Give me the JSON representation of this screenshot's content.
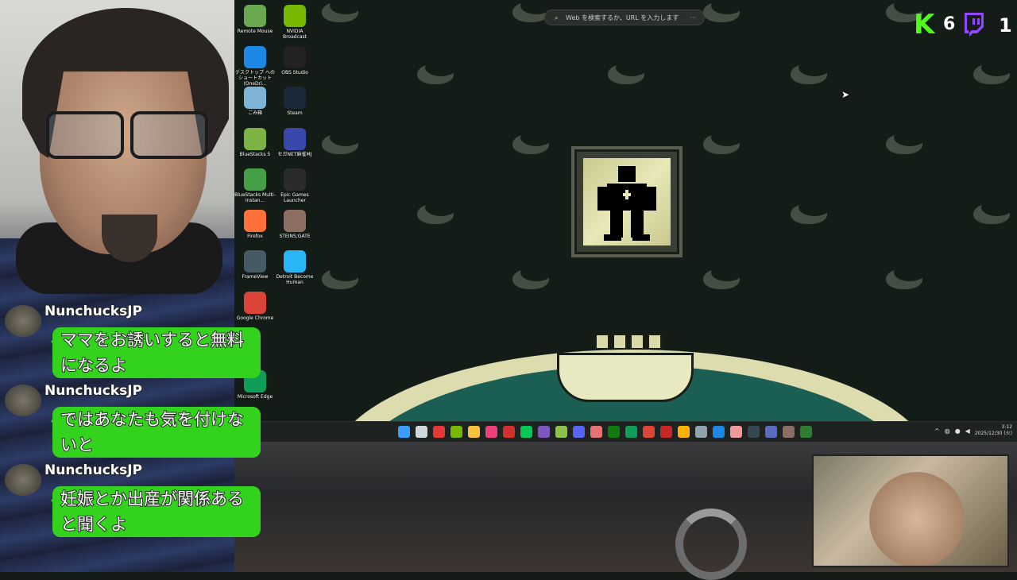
{
  "desktop_icons": [
    {
      "label": "Remote Mouse",
      "icon": "remote-mouse-icon",
      "color": "#6aa84f"
    },
    {
      "label": "NVIDIA Broadcast",
      "icon": "nvidia-broadcast-icon",
      "color": "#76b900"
    },
    {
      "label": "デスクトップ へのショートカット (OneDri...",
      "icon": "onedrive-icon",
      "color": "#1e88e5"
    },
    {
      "label": "OBS Studio",
      "icon": "obs-icon",
      "color": "#222222"
    },
    {
      "label": "ごみ箱",
      "icon": "recycle-bin-icon",
      "color": "#7fb3d5"
    },
    {
      "label": "Steam",
      "icon": "steam-icon",
      "color": "#1b2838"
    },
    {
      "label": "BlueStacks 5",
      "icon": "bluestacks-icon",
      "color": "#7cb342"
    },
    {
      "label": "セガNET麻雀MJ",
      "icon": "sega-mj-icon",
      "color": "#3949ab"
    },
    {
      "label": "BlueStacks Multi-Instan...",
      "icon": "bluestacks-multi-icon",
      "color": "#43a047"
    },
    {
      "label": "Epic Games Launcher",
      "icon": "epic-games-icon",
      "color": "#2b2b2b"
    },
    {
      "label": "Firefox",
      "icon": "firefox-icon",
      "color": "#ff7139"
    },
    {
      "label": "STEINS;GATE",
      "icon": "steins-gate-icon",
      "color": "#8d6e63"
    },
    {
      "label": "FrameView",
      "icon": "frameview-icon",
      "color": "#455a64"
    },
    {
      "label": "Detroit Become Human",
      "icon": "detroit-icon",
      "color": "#29b6f6"
    },
    {
      "label": "Google Chrome",
      "icon": "chrome-icon",
      "color": "#db4437"
    },
    {
      "label": "Microsoft Edge",
      "icon": "edge-icon",
      "color": "#0f9d58"
    }
  ],
  "search": {
    "placeholder": "Web を検索するか、URL を入力します",
    "icon": "search-icon",
    "more": "···"
  },
  "stream": {
    "kick_logo": "K",
    "kick_count": "6",
    "twitch_icon": "twitch-icon",
    "twitch_count": "1"
  },
  "taskbar": {
    "icons": [
      {
        "name": "start-icon",
        "color": "#3b9dfc"
      },
      {
        "name": "task-view-icon",
        "color": "#cfd8dc"
      },
      {
        "name": "obs-taskbar-icon",
        "color": "#e53935"
      },
      {
        "name": "nvidia-taskbar-icon",
        "color": "#76b900"
      },
      {
        "name": "file-explorer-icon",
        "color": "#f9c23c"
      },
      {
        "name": "app-pink-icon",
        "color": "#ec407a"
      },
      {
        "name": "record-icon",
        "color": "#d32f2f"
      },
      {
        "name": "line-icon",
        "color": "#06c755"
      },
      {
        "name": "app-purple-icon",
        "color": "#7e57c2"
      },
      {
        "name": "notepad-icon",
        "color": "#8bc34a"
      },
      {
        "name": "discord-icon",
        "color": "#5865f2"
      },
      {
        "name": "app-a-icon",
        "color": "#e57373"
      },
      {
        "name": "xbox-icon",
        "color": "#107c10"
      },
      {
        "name": "edge-taskbar-icon",
        "color": "#0f9d58"
      },
      {
        "name": "chrome-taskbar-icon",
        "color": "#db4437"
      },
      {
        "name": "app-red-icon",
        "color": "#c62828"
      },
      {
        "name": "app-gold-icon",
        "color": "#ffb300"
      },
      {
        "name": "app-arrow-icon",
        "color": "#90a4ae"
      },
      {
        "name": "app-blue-icon",
        "color": "#1e88e5"
      },
      {
        "name": "app-image-icon",
        "color": "#ef9a9a"
      },
      {
        "name": "app-dark-icon",
        "color": "#37474f"
      },
      {
        "name": "app-doc-icon",
        "color": "#5c6bc0"
      },
      {
        "name": "app-box-icon",
        "color": "#8d6e63"
      },
      {
        "name": "app-green-icon",
        "color": "#2e7d32"
      }
    ],
    "tray_chevron": "^",
    "clock_time": "3:12",
    "clock_date": "2025/12/30 (火)"
  },
  "chat": [
    {
      "user": "NunchucksJP",
      "text": "ママをお誘いすると無料になるよ"
    },
    {
      "user": "NunchucksJP",
      "text": "ではあなたも気を付けないと"
    },
    {
      "user": "NunchucksJP",
      "text": "妊娠とか出産が関係あると聞くよ"
    }
  ]
}
